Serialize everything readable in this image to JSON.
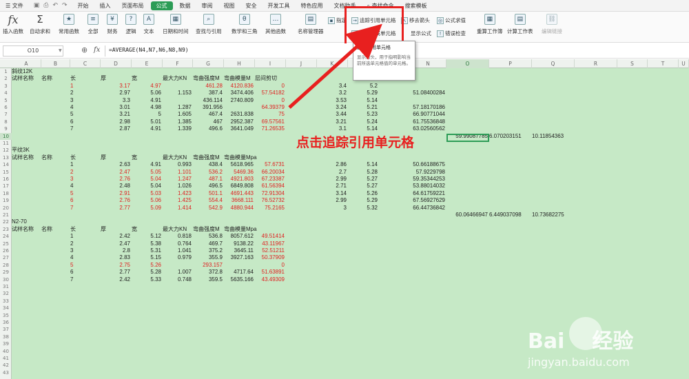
{
  "menu": {
    "file": "文件",
    "items": [
      "开始",
      "插入",
      "页面布局",
      "公式",
      "数据",
      "审阅",
      "视图",
      "安全",
      "开发工具",
      "特色应用",
      "文档助手",
      "查找命令",
      "搜索模板"
    ],
    "active": "公式"
  },
  "ribbon": {
    "buttons": [
      "插入函数",
      "自动求和",
      "常用函数",
      "全部",
      "财务",
      "逻辑",
      "文本",
      "日期和时间",
      "查找与引用",
      "数学和三角",
      "其他函数",
      "名称管理器"
    ],
    "small": {
      "paste": "指定",
      "trace_precedents": "追踪引用单元格",
      "trace_dependents": "追踪从属单元格",
      "move_arrows": "移去箭头",
      "show_formula": "显示公式",
      "eval_formula": "公式求值",
      "error_check": "错误检查",
      "calc_sheet": "重算工作簿",
      "calc_worksheet": "计算工作表",
      "edit_link": "编辑链接"
    }
  },
  "tooltip": {
    "title": "追踪引用单元格",
    "desc": "显示箭头，用于指明影响当前所选单元格值的单元格。"
  },
  "formula_bar": {
    "name_box": "O10",
    "fx": "fx",
    "formula": "=AVERAGE(N4,N7,N6,N8,N9)"
  },
  "columns": [
    "A",
    "B",
    "C",
    "D",
    "E",
    "F",
    "G",
    "H",
    "I",
    "J",
    "K",
    "L",
    "M",
    "N",
    "O",
    "P",
    "Q",
    "R",
    "S",
    "T",
    "U"
  ],
  "selected_column": "O",
  "selected_row": 10,
  "instruction": "点击追踪引用单元格",
  "watermark": {
    "brand": "Bai",
    "mid": "经验",
    "url": "jingyan.baidu.com"
  },
  "sections": [
    {
      "title": "斜纹12K",
      "headers": {
        "a": "试样名称",
        "b": "名称",
        "c": "长",
        "d": "厚",
        "e": "宽",
        "f": "最大力KN",
        "g": "弯曲强度M",
        "h": "弯曲模量M",
        "i": "层间剪切"
      },
      "rows": [
        {
          "n": "1",
          "d": "3.17",
          "e": "4.97",
          "f": "",
          "g": "461.28",
          "h": "4120.836",
          "i": "0",
          "k": "3.4",
          "l": "5.2",
          "m": "",
          "o": "",
          "p": "",
          "q": "",
          "red": true
        },
        {
          "n": "2",
          "d": "2.97",
          "e": "5.06",
          "f": "1.153",
          "g": "387.4",
          "h": "3474.406",
          "i": "57.54182",
          "k": "3.2",
          "l": "5.29",
          "m": "51.08400284",
          "o": "",
          "p": "",
          "q": "",
          "red": false,
          "redI": true
        },
        {
          "n": "3",
          "d": "3.3",
          "e": "4.91",
          "f": "",
          "g": "436.114",
          "h": "2740.809",
          "i": "0",
          "k": "3.53",
          "l": "5.14",
          "m": "",
          "o": "",
          "p": "",
          "q": "",
          "red": false,
          "redI": true
        },
        {
          "n": "4",
          "d": "3.01",
          "e": "4.98",
          "f": "1.287",
          "g": "391.956",
          "h": "",
          "i": "64.39379",
          "k": "3.24",
          "l": "5.21",
          "m": "57.18170186",
          "o": "",
          "p": "",
          "q": "",
          "red": false,
          "redI": true
        },
        {
          "n": "5",
          "d": "3.21",
          "e": "5",
          "f": "1.605",
          "g": "467.4",
          "h": "2631.838",
          "i": "75",
          "k": "3.44",
          "l": "5.23",
          "m": "66.90771044",
          "o": "",
          "p": "",
          "q": "",
          "red": false,
          "redI": true
        },
        {
          "n": "6",
          "d": "2.98",
          "e": "5.01",
          "f": "1.385",
          "g": "467",
          "h": "2952.387",
          "i": "69.57561",
          "k": "3.21",
          "l": "5.24",
          "m": "61.75536848",
          "o": "",
          "p": "",
          "q": "",
          "red": false,
          "redI": true
        },
        {
          "n": "7",
          "d": "2.87",
          "e": "4.91",
          "f": "1.339",
          "g": "496.6",
          "h": "3641.049",
          "i": "71.26535",
          "k": "3.1",
          "l": "5.14",
          "m": "63.02560562",
          "o": "",
          "p": "",
          "q": "",
          "red": false,
          "redI": true
        }
      ],
      "summary": {
        "o": "59.99087785",
        "p": "6.070203151",
        "q": "10.11854363"
      }
    },
    {
      "title": "平纹3K",
      "headers": {
        "a": "试样名称",
        "b": "名称",
        "c": "长",
        "d": "厚",
        "e": "宽",
        "f": "最大力KN",
        "g": "弯曲强度M",
        "h": "弯曲模量Mpa",
        "i": ""
      },
      "rows": [
        {
          "n": "1",
          "d": "2.63",
          "e": "4.91",
          "f": "0.993",
          "g": "438.4",
          "h": "5618.965",
          "i": "57.6731",
          "k": "2.86",
          "l": "5.14",
          "m": "50.66188675",
          "red": false,
          "redI": true
        },
        {
          "n": "2",
          "d": "2.47",
          "e": "5.05",
          "f": "1.101",
          "g": "536.2",
          "h": "5469.36",
          "i": "66.20034",
          "k": "2.7",
          "l": "5.28",
          "m": "57.9229798",
          "red": true
        },
        {
          "n": "3",
          "d": "2.76",
          "e": "5.04",
          "f": "1.247",
          "g": "487.1",
          "h": "4921.803",
          "i": "67.23387",
          "k": "2.99",
          "l": "5.27",
          "m": "59.35344253",
          "red": true
        },
        {
          "n": "4",
          "d": "2.48",
          "e": "5.04",
          "f": "1.026",
          "g": "496.5",
          "h": "6849.808",
          "i": "61.56394",
          "k": "2.71",
          "l": "5.27",
          "m": "53.88014032",
          "red": false,
          "redI": true
        },
        {
          "n": "5",
          "d": "2.91",
          "e": "5.03",
          "f": "1.423",
          "g": "501.1",
          "h": "4691.443",
          "i": "72.91304",
          "k": "3.14",
          "l": "5.26",
          "m": "64.61759221",
          "red": true
        },
        {
          "n": "6",
          "d": "2.76",
          "e": "5.06",
          "f": "1.425",
          "g": "554.4",
          "h": "3668.111",
          "i": "76.52732",
          "k": "2.99",
          "l": "5.29",
          "m": "67.56927629",
          "red": true
        },
        {
          "n": "7",
          "d": "2.77",
          "e": "5.09",
          "f": "1.414",
          "g": "542.9",
          "h": "4880.944",
          "i": "75.2165",
          "k": "3",
          "l": "5.32",
          "m": "66.44736842",
          "red": true
        }
      ],
      "summary": {
        "o": "60.06466947",
        "p": "6.449037098",
        "q": "10.73682275"
      }
    },
    {
      "title": "N2-70",
      "headers": {
        "a": "试样名称",
        "b": "名称",
        "c": "长",
        "d": "厚",
        "e": "宽",
        "f": "最大力KN",
        "g": "弯曲强度M",
        "h": "弯曲模量Mpa",
        "i": ""
      },
      "rows": [
        {
          "n": "1",
          "d": "2.42",
          "e": "5.12",
          "f": "0.818",
          "g": "536.8",
          "h": "8057.612",
          "i": "49.51414",
          "red": false,
          "redI": true
        },
        {
          "n": "2",
          "d": "2.47",
          "e": "5.38",
          "f": "0.764",
          "g": "469.7",
          "h": "9138.22",
          "i": "43.11967",
          "red": false,
          "redI": true
        },
        {
          "n": "3",
          "d": "2.8",
          "e": "5.31",
          "f": "1.041",
          "g": "375.2",
          "h": "3645.11",
          "i": "52.51211",
          "red": false,
          "redI": true
        },
        {
          "n": "4",
          "d": "2.83",
          "e": "5.15",
          "f": "0.979",
          "g": "355.9",
          "h": "3927.163",
          "i": "50.37909",
          "red": false,
          "redI": true
        },
        {
          "n": "5",
          "d": "2.75",
          "e": "5.26",
          "f": "",
          "g": "293.157",
          "h": "",
          "i": "0",
          "red": true
        },
        {
          "n": "6",
          "d": "2.77",
          "e": "5.28",
          "f": "1.007",
          "g": "372.8",
          "h": "4717.64",
          "i": "51.63891",
          "red": false,
          "redI": true
        },
        {
          "n": "7",
          "d": "2.42",
          "e": "5.33",
          "f": "0.748",
          "g": "359.5",
          "h": "5635.166",
          "i": "43.49309",
          "red": false,
          "redI": true
        }
      ]
    }
  ],
  "colors": {
    "accent": "#2c9c56",
    "highlight": "#e8201f",
    "grid_bg": "#c6e9c6",
    "red_text": "#e02020"
  }
}
